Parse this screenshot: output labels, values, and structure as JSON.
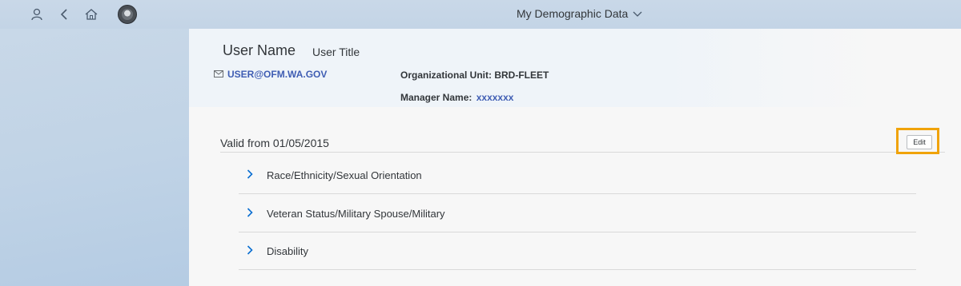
{
  "shell": {
    "app_title": "My Demographic Data",
    "icons": [
      "user-icon",
      "back-icon",
      "home-icon",
      "state-seal-logo",
      "chevron-down-icon"
    ]
  },
  "header": {
    "user_name": "User Name",
    "user_title": "User Title",
    "email": "USER@OFM.WA.GOV",
    "org_unit": "Organizational Unit: BRD-FLEET",
    "manager_label": "Manager Name:",
    "manager_value": "xxxxxxx"
  },
  "content": {
    "valid_from": "Valid from 01/05/2015",
    "edit_label": "Edit",
    "sections": [
      {
        "label": "Race/Ethnicity/Sexual Orientation"
      },
      {
        "label": "Veteran Status/Military Spouse/Military"
      },
      {
        "label": "Disability"
      }
    ]
  },
  "colors": {
    "highlight": "#f0a30a",
    "link": "#3f5db3",
    "chevron": "#0a6ed1"
  }
}
